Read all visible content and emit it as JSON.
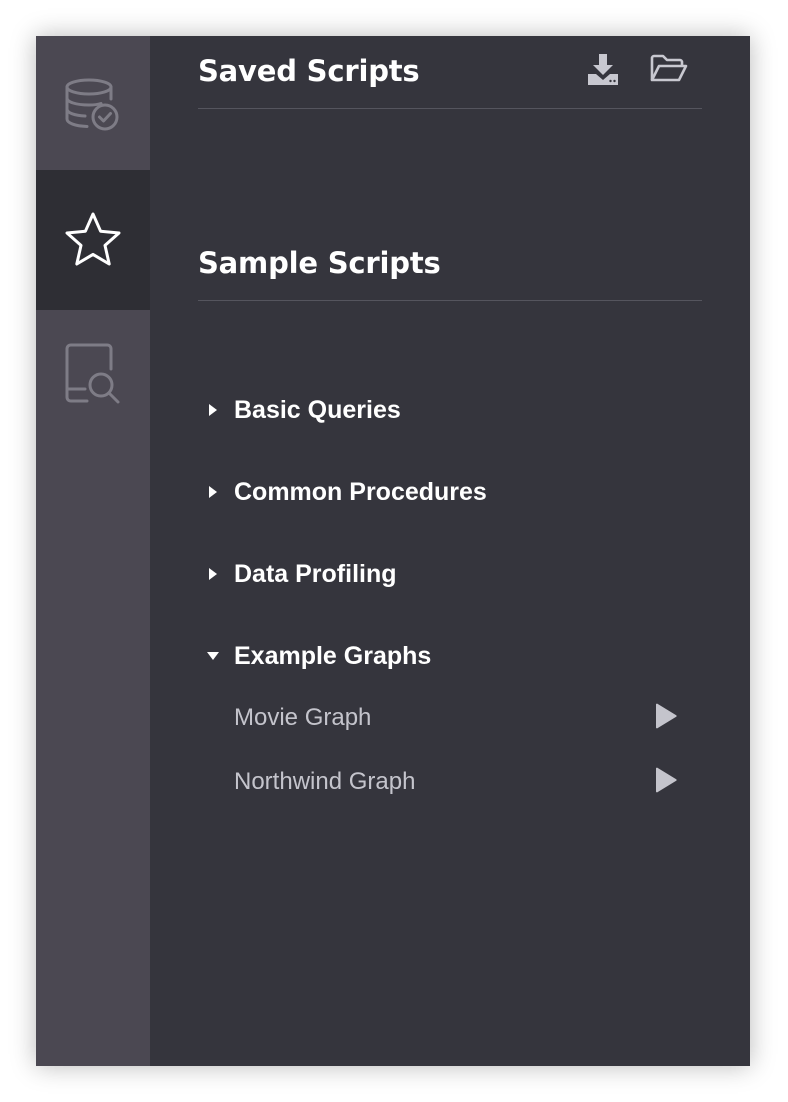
{
  "sidebar": {
    "items": [
      {
        "name": "database",
        "icon": "database-check-icon"
      },
      {
        "name": "favorites",
        "icon": "star-icon",
        "active": true
      },
      {
        "name": "documents",
        "icon": "document-search-icon"
      }
    ]
  },
  "saved_scripts": {
    "title": "Saved Scripts",
    "actions": [
      "download-icon",
      "folder-open-icon"
    ]
  },
  "sample_scripts": {
    "title": "Sample Scripts",
    "folders": [
      {
        "label": "Basic Queries",
        "expanded": false
      },
      {
        "label": "Common Procedures",
        "expanded": false
      },
      {
        "label": "Data Profiling",
        "expanded": false
      },
      {
        "label": "Example Graphs",
        "expanded": true,
        "scripts": [
          {
            "label": "Movie Graph"
          },
          {
            "label": "Northwind Graph"
          }
        ]
      }
    ]
  },
  "colors": {
    "panel_bg": "#35353d",
    "rail_bg": "#4b4852",
    "rail_active_bg": "#2e2e34",
    "title_text": "#ffffff",
    "script_text": "#c4c4cc"
  }
}
